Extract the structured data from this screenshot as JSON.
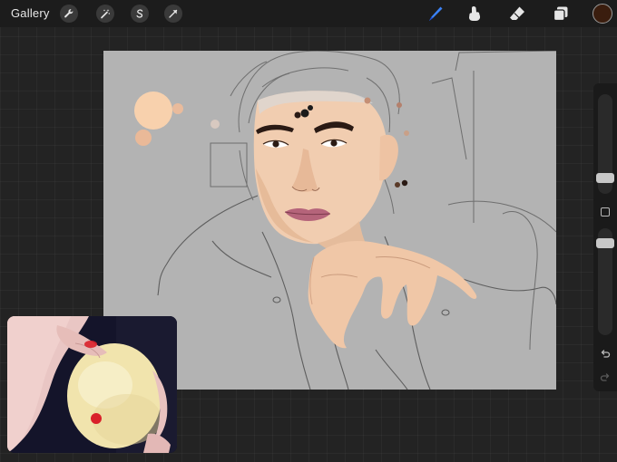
{
  "toolbar": {
    "gallery_label": "Gallery",
    "actions": [
      {
        "name": "actions-wrench-icon"
      },
      {
        "name": "adjustments-wand-icon"
      },
      {
        "name": "selection-s-icon"
      },
      {
        "name": "transform-arrow-icon"
      }
    ],
    "tools": [
      {
        "name": "brush-icon",
        "active": true,
        "color": "#3b82f6"
      },
      {
        "name": "smudge-icon",
        "active": false,
        "color": "#e6e6e6"
      },
      {
        "name": "eraser-icon",
        "active": false,
        "color": "#e6e6e6"
      },
      {
        "name": "layers-icon",
        "active": false,
        "color": "#e6e6e6"
      }
    ],
    "current_color": "#3a1d0e"
  },
  "canvas": {
    "background": "#b3b3b3",
    "skin_color": "#f1cdb0"
  },
  "sidebar": {
    "undo_icon": "undo-icon",
    "redo_icon": "redo-icon",
    "modify_icon": "modify-square-icon"
  },
  "reference": {
    "ball_color": "#f3e8b4",
    "dot_color": "#d9202a"
  }
}
